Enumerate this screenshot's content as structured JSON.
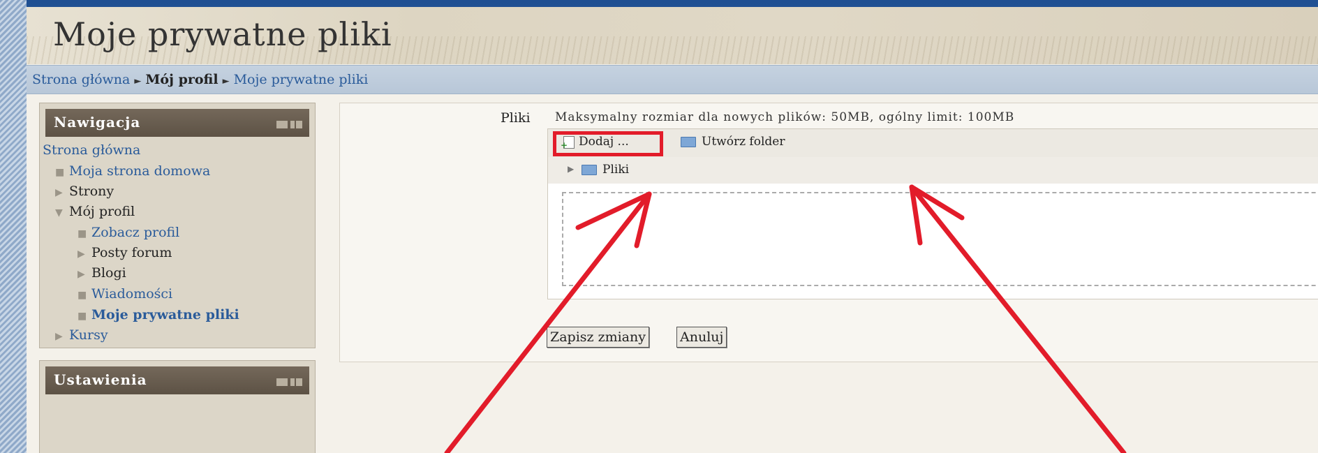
{
  "header": {
    "title": "Moje prywatne pliki"
  },
  "breadcrumb": {
    "home": "Strona główna",
    "separator": "►",
    "profile": "Mój profil",
    "current": "Moje prywatne pliki"
  },
  "navigation": {
    "title": "Nawigacja",
    "home": "Strona główna",
    "items": [
      {
        "label": "Moja strona domowa",
        "type": "link"
      },
      {
        "label": "Strony",
        "type": "collapsed"
      },
      {
        "label": "Mój profil",
        "type": "expanded"
      },
      {
        "label": "Zobacz profil",
        "type": "link"
      },
      {
        "label": "Posty forum",
        "type": "collapsed"
      },
      {
        "label": "Blogi",
        "type": "collapsed"
      },
      {
        "label": "Wiadomości",
        "type": "link"
      },
      {
        "label": "Moje prywatne pliki",
        "type": "current"
      },
      {
        "label": "Kursy",
        "type": "collapsed"
      }
    ]
  },
  "settings": {
    "title": "Ustawienia"
  },
  "files": {
    "label": "Pliki",
    "max_size_info": "Maksymalny rozmiar dla nowych plików: 50MB, ogólny limit: 100MB",
    "add_label": "Dodaj ...",
    "create_folder_label": "Utwórz folder",
    "root_folder": "Pliki"
  },
  "actions": {
    "save_label": "Zapisz zmiany",
    "cancel_label": "Anuluj"
  },
  "colors": {
    "highlight": "#e21c2a",
    "link": "#2a5b9a",
    "block_header": "#5d5245"
  },
  "icons": [
    "add-file-icon",
    "create-folder-icon",
    "folder-icon",
    "tree-expand-icon",
    "bullet-icon",
    "collapsed-arrow-icon",
    "expanded-arrow-icon"
  ]
}
